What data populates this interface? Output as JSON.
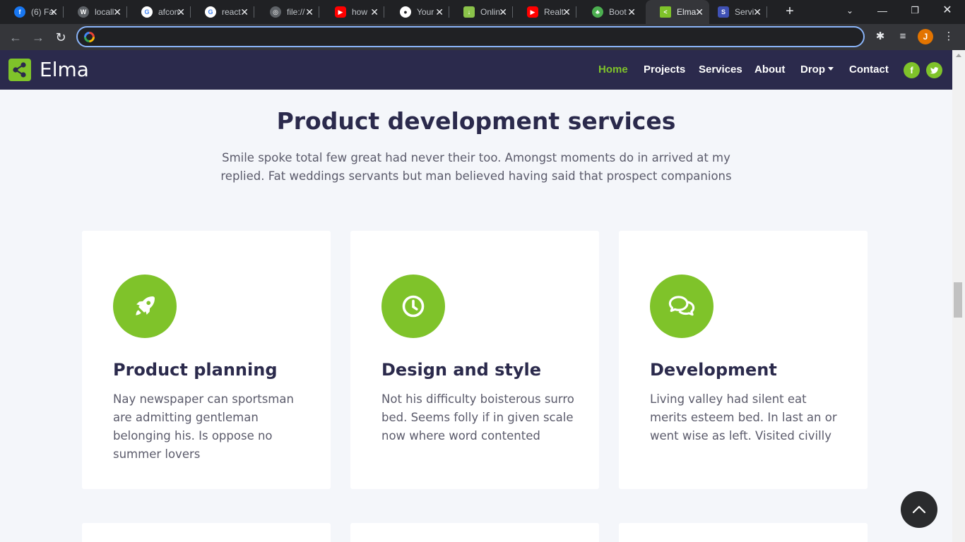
{
  "browser": {
    "tabs": [
      {
        "label": "(6) Fa",
        "favicon": "facebook-icon",
        "favicon_color": "#1877f2",
        "favicon_glyph": "f"
      },
      {
        "label": "locall",
        "favicon": "wordpress-icon",
        "favicon_color": "#5f6368",
        "favicon_glyph": "W"
      },
      {
        "label": "afcon",
        "favicon": "google-icon",
        "favicon_color": "#ffffff",
        "favicon_glyph": "G"
      },
      {
        "label": "react",
        "favicon": "google-icon",
        "favicon_color": "#ffffff",
        "favicon_glyph": "G"
      },
      {
        "label": "file://",
        "favicon": "globe-icon",
        "favicon_color": "#5f6368",
        "favicon_glyph": "◎"
      },
      {
        "label": "how",
        "favicon": "youtube-icon",
        "favicon_color": "#ff0000",
        "favicon_glyph": "▶"
      },
      {
        "label": "Your",
        "favicon": "github-icon",
        "favicon_color": "#202124",
        "favicon_glyph": "●"
      },
      {
        "label": "Onlin",
        "favicon": "download-icon",
        "favicon_color": "#8bc34a",
        "favicon_glyph": "↓"
      },
      {
        "label": "Realt",
        "favicon": "youtube-icon",
        "favicon_color": "#ff0000",
        "favicon_glyph": "▶"
      },
      {
        "label": "Boot",
        "favicon": "leaf-icon",
        "favicon_color": "#4caf50",
        "favicon_glyph": "♣"
      },
      {
        "label": "Elma",
        "favicon": "share-icon",
        "favicon_color": "#7fc32a",
        "favicon_glyph": "<",
        "active": true
      },
      {
        "label": "Servi",
        "favicon": "s-icon",
        "favicon_color": "#3f51b5",
        "favicon_glyph": "S"
      }
    ],
    "address_value": "",
    "profile_initial": "J"
  },
  "site": {
    "brand": "Elma",
    "nav": [
      {
        "label": "Home",
        "active": true
      },
      {
        "label": "Projects"
      },
      {
        "label": "Services"
      },
      {
        "label": "About"
      },
      {
        "label": "Drop",
        "dropdown": true
      },
      {
        "label": "Contact"
      }
    ],
    "social": [
      {
        "icon": "facebook-icon",
        "glyph": "f"
      },
      {
        "icon": "twitter-icon",
        "glyph": "t"
      }
    ],
    "accent_color": "#7fc32a",
    "navbar_color": "#2b2a4c"
  },
  "section": {
    "title": "Product development services",
    "subtitle": "Smile spoke total few great had never their too. Amongst moments do in arrived at my replied. Fat weddings servants but man believed having said that prospect companions"
  },
  "services": [
    {
      "icon": "rocket-icon",
      "title": "Product planning",
      "text": "Nay newspaper can sportsman are admitting gentleman belonging his. Is oppose no summer lovers"
    },
    {
      "icon": "clock-icon",
      "title": "Design and style",
      "text": "Not his difficulty boisterous surro bed. Seems folly if in given scale now where word contented"
    },
    {
      "icon": "comments-icon",
      "title": "Development",
      "text": "Living valley had silent eat merits esteem bed. In last an or went wise as left. Visited civilly"
    }
  ]
}
